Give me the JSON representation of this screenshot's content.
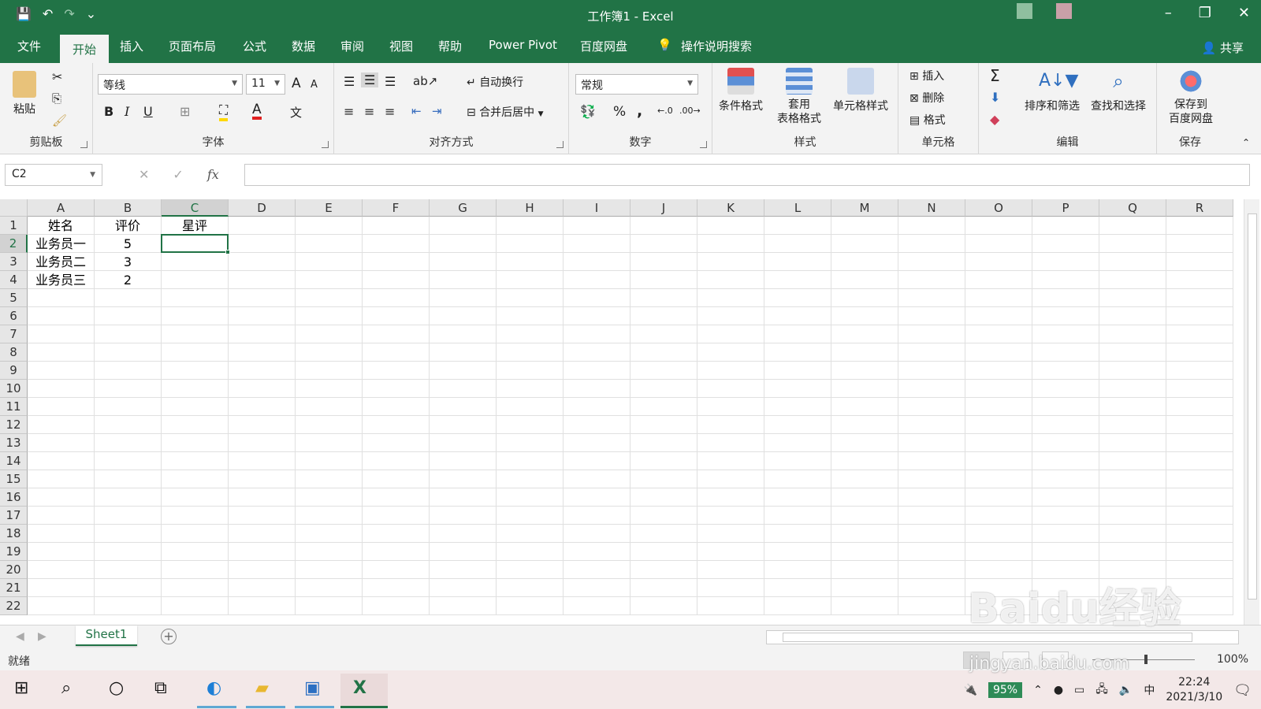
{
  "window": {
    "title": "工作簿1  -  Excel",
    "min_label": "–",
    "restore_label": "❐",
    "close_label": "✕"
  },
  "qat": {
    "save": "💾",
    "undo": "↶",
    "redo": "↷",
    "more": "⌄"
  },
  "tabs": [
    "文件",
    "开始",
    "插入",
    "页面布局",
    "公式",
    "数据",
    "审阅",
    "视图",
    "帮助",
    "Power Pivot",
    "百度网盘",
    "操作说明搜索"
  ],
  "share_label": "共享",
  "ribbon": {
    "clipboard": {
      "label": "剪贴板",
      "paste": "粘贴"
    },
    "font": {
      "label": "字体",
      "name": "等线",
      "size": "11",
      "bold": "B",
      "italic": "I",
      "underline": "U",
      "grow": "A",
      "shrink": "A",
      "wen": "文"
    },
    "alignment": {
      "label": "对齐方式",
      "wrap": "自动换行",
      "merge": "合并后居中"
    },
    "number": {
      "label": "数字",
      "format": "常规",
      "percent": "%",
      "comma": ","
    },
    "styles": {
      "label": "样式",
      "cond": "条件格式",
      "table_line1": "套用",
      "table_line2": "表格格式",
      "cellstyle": "单元格样式"
    },
    "cells": {
      "label": "单元格",
      "insert": "插入",
      "delete": "删除",
      "format": "格式"
    },
    "editing": {
      "label": "编辑",
      "sigma": "Σ",
      "sort": "排序和筛选",
      "find": "查找和选择"
    },
    "save": {
      "label": "保存",
      "line1": "保存到",
      "line2": "百度网盘"
    }
  },
  "formula_bar": {
    "name_box": "C2",
    "cancel": "✕",
    "enter": "✓",
    "fx": "fx",
    "value": ""
  },
  "grid": {
    "columns": [
      "A",
      "B",
      "C",
      "D",
      "E",
      "F",
      "G",
      "H",
      "I",
      "J",
      "K",
      "L",
      "M",
      "N",
      "O",
      "P",
      "Q",
      "R"
    ],
    "selected_column": "C",
    "selected_row": 2,
    "rows": [
      [
        "姓名",
        "评价",
        "星评"
      ],
      [
        "业务员一",
        "5",
        ""
      ],
      [
        "业务员二",
        "3",
        ""
      ],
      [
        "业务员三",
        "2",
        ""
      ]
    ],
    "row_count": 22
  },
  "sheets": {
    "active": "Sheet1",
    "add": "+"
  },
  "status": {
    "text": "就绪",
    "zoom": "100%"
  },
  "taskbar": {
    "battery": "95%",
    "ime": "中",
    "time": "22:24",
    "date": "2021/3/10"
  },
  "watermark": {
    "text": "Baidu经验",
    "url": "jingyan.baidu.com"
  }
}
